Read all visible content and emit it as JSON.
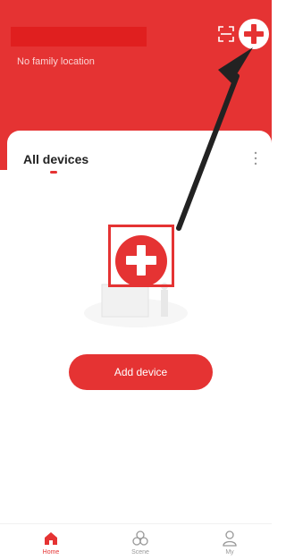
{
  "header": {
    "location_text": "No family location",
    "scan_icon": "scan-icon",
    "add_icon": "plus-circle-icon"
  },
  "devices": {
    "section_title": "All devices",
    "more_icon": "more-vertical-icon",
    "add_button_label": "Add device",
    "highlight_icon": "plus-circle-icon"
  },
  "nav": {
    "items": [
      {
        "label": "Home",
        "icon": "home-icon"
      },
      {
        "label": "Scene",
        "icon": "scene-icon"
      },
      {
        "label": "My",
        "icon": "user-icon"
      }
    ]
  },
  "colors": {
    "accent": "#e53333",
    "annotation_arrow": "#222222",
    "inactive": "#999999"
  }
}
